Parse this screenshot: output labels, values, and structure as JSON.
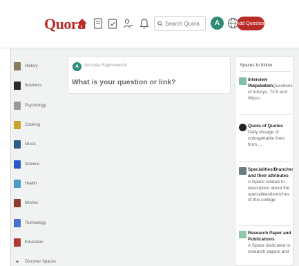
{
  "header": {
    "logo": "Quora",
    "search": {
      "placeholder": "Search Quora",
      "value": ""
    },
    "avatar_initial": "A",
    "add_question_label": "Add Question",
    "brand_color": "#b92b27",
    "nav_icons": [
      "home-icon",
      "answer-icon",
      "tasks-icon",
      "people-icon",
      "bell-icon"
    ]
  },
  "sidebar": {
    "items": [
      {
        "label": "History",
        "icon": "history-thumb",
        "color": "#8a7a62"
      },
      {
        "label": "Business",
        "icon": "business-thumb",
        "color": "#2b2b2b"
      },
      {
        "label": "Psychology",
        "icon": "psychology-thumb",
        "color": "#9a9a9a"
      },
      {
        "label": "Cooking",
        "icon": "cooking-thumb",
        "color": "#c9a22f"
      },
      {
        "label": "Music",
        "icon": "music-thumb",
        "color": "#2e5a86"
      },
      {
        "label": "Science",
        "icon": "science-thumb",
        "color": "#2a5bc7"
      },
      {
        "label": "Health",
        "icon": "health-thumb",
        "color": "#4b9ac9"
      },
      {
        "label": "Movies",
        "icon": "movies-thumb",
        "color": "#8b3a2b"
      },
      {
        "label": "Technology",
        "icon": "technology-thumb",
        "color": "#4a6fd0"
      },
      {
        "label": "Education",
        "icon": "education-thumb",
        "color": "#b03a33"
      }
    ],
    "discover_label": "Discover Spaces"
  },
  "ask": {
    "avatar_initial": "A",
    "user_name": "Anushka Raghuwanshi",
    "question_placeholder": "What is your question or link?"
  },
  "spaces": {
    "title": "Spaces to follow",
    "items": [
      {
        "name": "Interview Preparation",
        "description": "Most Asked Questions of Infosys, TCS and Wipro",
        "icon": "interview-thumb",
        "color": "#7fbfb0"
      },
      {
        "name": "Quota of Quotes",
        "description": "Daily dosage of unforgettable lines from ...",
        "icon": "quotes-thumb",
        "color": "#222222"
      },
      {
        "name": "Specialities/Branches and their attributes",
        "description": "A Space related to description about the specialities/branches of this college",
        "icon": "specialities-thumb",
        "color": "#6b7b86"
      },
      {
        "name": "Research Paper and Publications",
        "description": "A Space dedicated to research papers and",
        "icon": "research-thumb",
        "color": "#8fc7a8"
      }
    ]
  }
}
